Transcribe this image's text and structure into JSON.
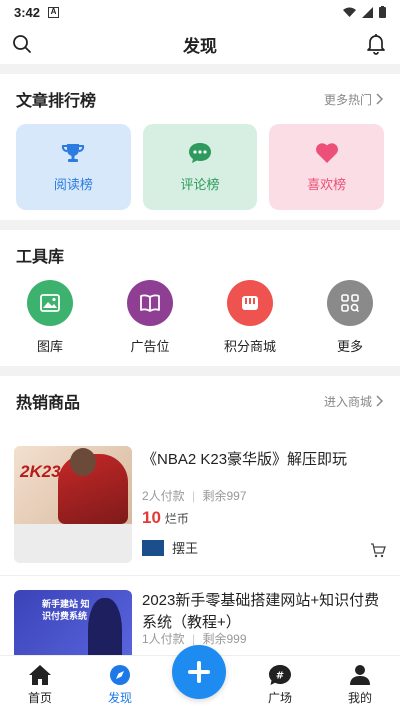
{
  "status": {
    "time": "3:42",
    "badge": "A"
  },
  "header": {
    "title": "发现"
  },
  "articles": {
    "title": "文章排行榜",
    "more": "更多热门",
    "items": [
      {
        "label": "阅读榜",
        "icon": "trophy-icon"
      },
      {
        "label": "评论榜",
        "icon": "chat-bubble-icon"
      },
      {
        "label": "喜欢榜",
        "icon": "heart-icon"
      }
    ]
  },
  "tools": {
    "title": "工具库",
    "items": [
      {
        "label": "图库",
        "icon": "image-icon",
        "color": "#3db26f"
      },
      {
        "label": "广告位",
        "icon": "book-icon",
        "color": "#8e3f93"
      },
      {
        "label": "积分商城",
        "icon": "shop-icon",
        "color": "#ef5350"
      },
      {
        "label": "更多",
        "icon": "grid-icon",
        "color": "#8a8a8a"
      }
    ]
  },
  "products": {
    "title": "热销商品",
    "more": "进入商城",
    "items": [
      {
        "title": "《NBA2 K23豪华版》解压即玩",
        "buyers": "2人付款",
        "stock": "剩余997",
        "price": "10",
        "unit": "烂币",
        "seller": "摆王",
        "thumb_text": "2K23"
      },
      {
        "title": "2023新手零基础搭建网站+知识付费系统（教程+）",
        "buyers": "1人付款",
        "stock": "剩余999",
        "thumb_text": "新手建站 知识付费系统"
      }
    ]
  },
  "tabbar": {
    "items": [
      {
        "label": "首页",
        "icon": "home-icon"
      },
      {
        "label": "发现",
        "icon": "compass-icon",
        "active": true
      },
      {
        "label": "广场",
        "icon": "hash-bubble-icon"
      },
      {
        "label": "我的",
        "icon": "user-icon"
      }
    ],
    "fab": "plus-icon"
  }
}
